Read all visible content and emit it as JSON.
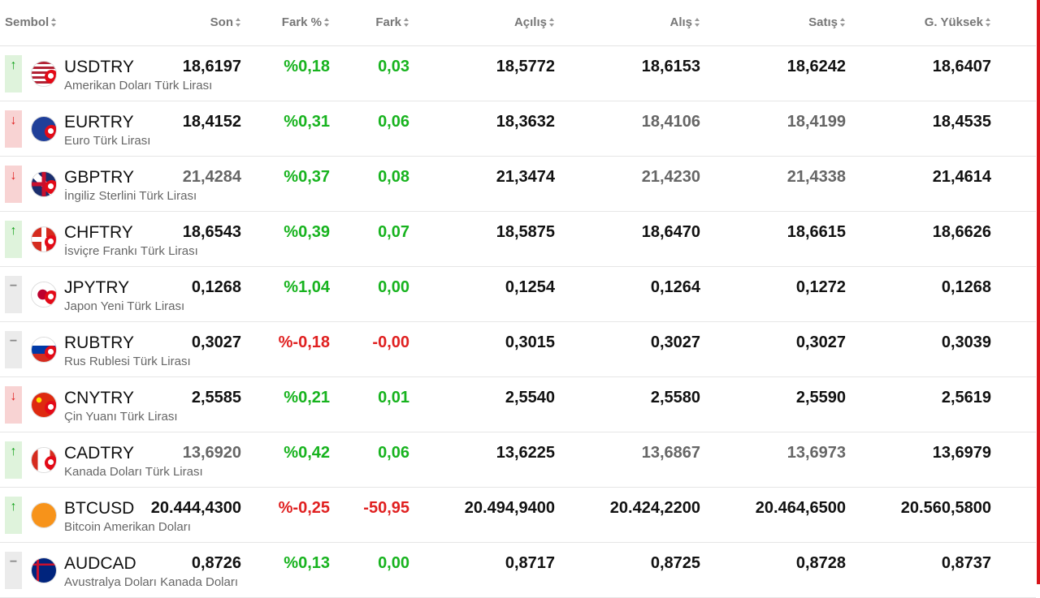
{
  "header": {
    "symbol": "Sembol",
    "son": "Son",
    "fark_pct": "Fark %",
    "fark": "Fark",
    "acilis": "Açılış",
    "alis": "Alış",
    "satis": "Satış",
    "g_yuksek": "G. Yüksek"
  },
  "colors": {
    "positive": "#17b31e",
    "negative": "#e02020",
    "trend_up_bg": "#dff3dc",
    "trend_down_bg": "#f8d3d3",
    "trend_flat_bg": "#ebebeb",
    "side_rule": "#d7141a"
  },
  "rows": [
    {
      "trend": "up",
      "trend_glyph": "↑",
      "flag": "us-flag-icon",
      "symbol": "USDTRY",
      "name": "Amerikan Doları Türk Lirası",
      "son": "18,6197",
      "fark_pct": "%0,18",
      "fark": "0,03",
      "acilis": "18,5772",
      "alis": "18,6153",
      "satis": "18,6242",
      "g_yuksek": "18,6407"
    },
    {
      "trend": "down",
      "trend_glyph": "↓",
      "flag": "eu-flag-icon",
      "symbol": "EURTRY",
      "name": "Euro Türk Lirası",
      "son": "18,4152",
      "fark_pct": "%0,31",
      "fark": "0,06",
      "acilis": "18,3632",
      "alis": "18,4106",
      "satis": "18,4199",
      "g_yuksek": "18,4535"
    },
    {
      "trend": "down",
      "trend_glyph": "↓",
      "flag": "gb-flag-icon",
      "symbol": "GBPTRY",
      "name": "İngiliz Sterlini Türk Lirası",
      "son": "21,4284",
      "fark_pct": "%0,37",
      "fark": "0,08",
      "acilis": "21,3474",
      "alis": "21,4230",
      "satis": "21,4338",
      "g_yuksek": "21,4614"
    },
    {
      "trend": "up",
      "trend_glyph": "↑",
      "flag": "ch-flag-icon",
      "symbol": "CHFTRY",
      "name": "İsviçre Frankı Türk Lirası",
      "son": "18,6543",
      "fark_pct": "%0,39",
      "fark": "0,07",
      "acilis": "18,5875",
      "alis": "18,6470",
      "satis": "18,6615",
      "g_yuksek": "18,6626"
    },
    {
      "trend": "flat",
      "trend_glyph": "−",
      "flag": "jp-flag-icon",
      "symbol": "JPYTRY",
      "name": "Japon Yeni Türk Lirası",
      "son": "0,1268",
      "fark_pct": "%1,04",
      "fark": "0,00",
      "acilis": "0,1254",
      "alis": "0,1264",
      "satis": "0,1272",
      "g_yuksek": "0,1268"
    },
    {
      "trend": "flat",
      "trend_glyph": "−",
      "flag": "ru-flag-icon",
      "symbol": "RUBTRY",
      "name": "Rus Rublesi Türk Lirası",
      "son": "0,3027",
      "fark_pct": "%-0,18",
      "fark": "-0,00",
      "acilis": "0,3015",
      "alis": "0,3027",
      "satis": "0,3027",
      "g_yuksek": "0,3039"
    },
    {
      "trend": "down",
      "trend_glyph": "↓",
      "flag": "cn-flag-icon",
      "symbol": "CNYTRY",
      "name": "Çin Yuanı Türk Lirası",
      "son": "2,5585",
      "fark_pct": "%0,21",
      "fark": "0,01",
      "acilis": "2,5540",
      "alis": "2,5580",
      "satis": "2,5590",
      "g_yuksek": "2,5619"
    },
    {
      "trend": "up",
      "trend_glyph": "↑",
      "flag": "ca-flag-icon",
      "symbol": "CADTRY",
      "name": "Kanada Doları Türk Lirası",
      "son": "13,6920",
      "fark_pct": "%0,42",
      "fark": "0,06",
      "acilis": "13,6225",
      "alis": "13,6867",
      "satis": "13,6973",
      "g_yuksek": "13,6979"
    },
    {
      "trend": "up",
      "trend_glyph": "↑",
      "flag": "btc-icon",
      "symbol": "BTCUSD",
      "name": "Bitcoin Amerikan Doları",
      "son": "20.444,4300",
      "fark_pct": "%-0,25",
      "fark": "-50,95",
      "acilis": "20.494,9400",
      "alis": "20.424,2200",
      "satis": "20.464,6500",
      "g_yuksek": "20.560,5800"
    },
    {
      "trend": "flat",
      "trend_glyph": "−",
      "flag": "au-flag-icon",
      "symbol": "AUDCAD",
      "name": "Avustralya Doları Kanada Doları",
      "son": "0,8726",
      "fark_pct": "%0,13",
      "fark": "0,00",
      "acilis": "0,8717",
      "alis": "0,8725",
      "satis": "0,8728",
      "g_yuksek": "0,8737"
    }
  ]
}
